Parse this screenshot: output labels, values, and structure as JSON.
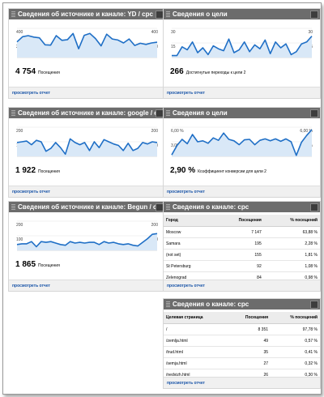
{
  "widgets": [
    {
      "id": "w1",
      "title": "Сведения об источнике и каналe: YD / cpc",
      "value": "4 754",
      "label": "Посещения",
      "link": "просмотреть отчет"
    },
    {
      "id": "w2",
      "title": "Сведения о цели",
      "value": "266",
      "label": "Достигнутые переходы к цели 2",
      "link": "просмотреть отчет"
    },
    {
      "id": "w3",
      "title": "Сведения об источнике и канале: google / cpc",
      "value": "1 922",
      "label": "Посещения",
      "link": "просмотреть отчет"
    },
    {
      "id": "w4",
      "title": "Сведения о цели",
      "value": "2,90 %",
      "label": "Коэффициент конверсии для цели 2",
      "link": "просмотреть отчет"
    },
    {
      "id": "w5",
      "title": "Сведения об источнике и канале: Begun / cpc",
      "value": "1 865",
      "label": "Посещения",
      "link": "просмотреть отчет"
    },
    {
      "id": "w6",
      "title": "Сведения о канале: cpc",
      "link": "просмотреть отчет",
      "headers": [
        "Город",
        "Посещения",
        "% посещений"
      ],
      "rows": [
        [
          "Moscow",
          "7 147",
          "63,88 %"
        ],
        [
          "Samara",
          "195",
          "2,28 %"
        ],
        [
          "(not set)",
          "155",
          "1,81 %"
        ],
        [
          "St Petersburg",
          "92",
          "1,08 %"
        ],
        [
          "Zelenograd",
          "84",
          "0,98 %"
        ]
      ]
    },
    {
      "id": "w7",
      "title": "Сведения о канале: cpc",
      "link": "просмотреть отчет",
      "headers": [
        "Целевая страница",
        "Посещения",
        "% посещений"
      ],
      "rows": [
        [
          "/",
          "8 351",
          "97,78 %"
        ],
        [
          "/zemlja.html",
          "49",
          "0,57 %"
        ],
        [
          "/trud.html",
          "35",
          "0,41 %"
        ],
        [
          "/semja.html",
          "27",
          "0,32 %"
        ],
        [
          "/nedvizh.html",
          "26",
          "0,30 %"
        ]
      ]
    }
  ],
  "chart_data": [
    {
      "type": "area",
      "widget": "w1",
      "ylim": [
        0,
        400
      ],
      "ticks_left": [
        "400",
        "200"
      ],
      "ticks_right": [
        "400",
        "200"
      ],
      "values": [
        215,
        285,
        300,
        280,
        270,
        175,
        170,
        300,
        235,
        245,
        330,
        120,
        305,
        330,
        260,
        160,
        320,
        255,
        240,
        200,
        255,
        165,
        195,
        180,
        200,
        210
      ]
    },
    {
      "type": "area",
      "widget": "w2",
      "ylim": [
        0,
        30
      ],
      "ticks_left": [
        "30",
        "15"
      ],
      "ticks_right": [
        "30",
        "15"
      ],
      "values": [
        2,
        2,
        11,
        8,
        16,
        5,
        10,
        3,
        12,
        9,
        7,
        19,
        5,
        8,
        16,
        6,
        13,
        9,
        18,
        4,
        16,
        10,
        14,
        3,
        6,
        14,
        16,
        22
      ]
    },
    {
      "type": "area",
      "widget": "w3",
      "ylim": [
        0,
        200
      ],
      "ticks_left": [
        "200",
        "100"
      ],
      "ticks_right": [
        "200",
        "100"
      ],
      "values": [
        95,
        100,
        105,
        80,
        110,
        100,
        35,
        55,
        95,
        60,
        15,
        120,
        95,
        80,
        95,
        40,
        100,
        60,
        115,
        100,
        85,
        75,
        40,
        90,
        40,
        55,
        95,
        85,
        100,
        95
      ]
    },
    {
      "type": "area",
      "widget": "w4",
      "ylim": [
        0,
        6
      ],
      "ticks_left": [
        "6,00 %",
        "3,00 %"
      ],
      "ticks_right": [
        "6,00 %",
        "3,00 %"
      ],
      "values": [
        0.3,
        2.2,
        3.5,
        2.6,
        4.5,
        3.0,
        3.2,
        2.7,
        3.8,
        3.3,
        4.8,
        3.5,
        3.2,
        2.4,
        3.4,
        3.5,
        2.4,
        3.3,
        3.6,
        3.2,
        3.6,
        3.1,
        3.6,
        3.0,
        0.2,
        2.9,
        4.3,
        5.5
      ]
    },
    {
      "type": "area",
      "widget": "w5",
      "ylim": [
        0,
        200
      ],
      "ticks_left": [
        "200",
        "100"
      ],
      "ticks_right": [
        "200",
        "100"
      ],
      "values": [
        40,
        45,
        45,
        60,
        25,
        60,
        55,
        60,
        50,
        40,
        35,
        60,
        50,
        55,
        50,
        55,
        55,
        40,
        60,
        50,
        55,
        45,
        40,
        45,
        35,
        30,
        55,
        80,
        110,
        115
      ]
    }
  ]
}
